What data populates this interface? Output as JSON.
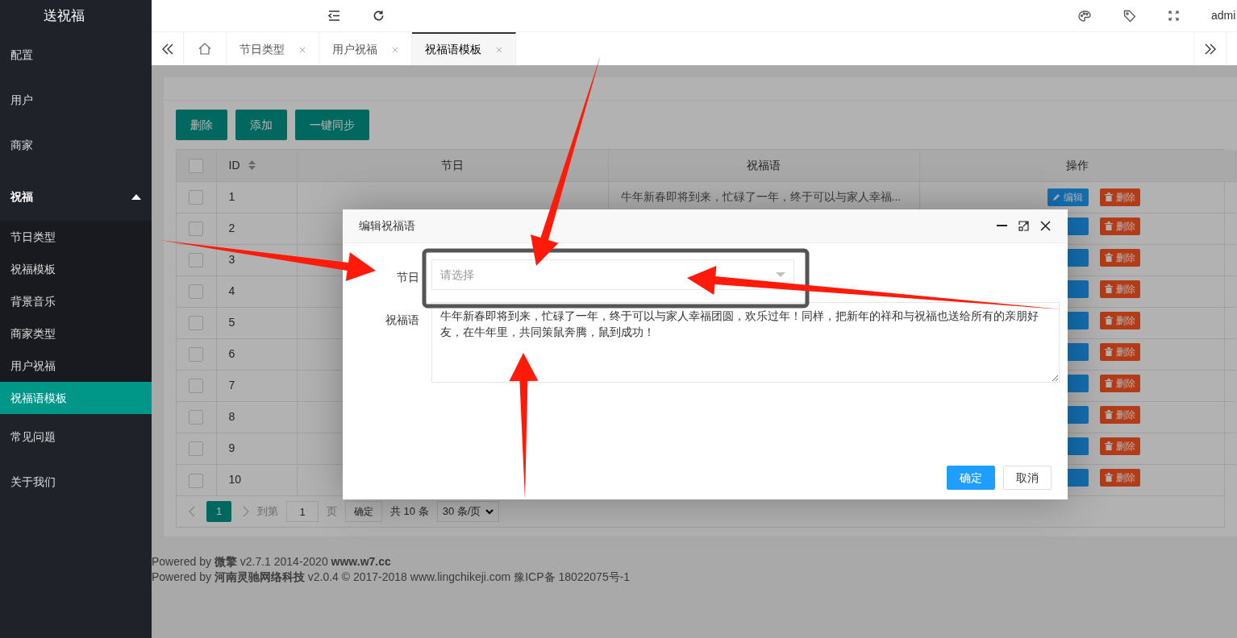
{
  "sidebar": {
    "logo": "送祝福",
    "items": [
      {
        "label": "配置",
        "expanded": false,
        "selected": false
      },
      {
        "label": "用户",
        "expanded": false,
        "selected": false
      },
      {
        "label": "商家",
        "expanded": false,
        "selected": false
      },
      {
        "label": "祝福",
        "expanded": true,
        "selected": false,
        "children": [
          {
            "label": "节日类型",
            "selected": false
          },
          {
            "label": "祝福模板",
            "selected": false
          },
          {
            "label": "背景音乐",
            "selected": false
          },
          {
            "label": "商家类型",
            "selected": false
          },
          {
            "label": "用户祝福",
            "selected": false
          },
          {
            "label": "祝福语模板",
            "selected": true
          }
        ]
      },
      {
        "label": "常见问题",
        "expanded": false,
        "selected": false
      },
      {
        "label": "关于我们",
        "expanded": false,
        "selected": false
      }
    ]
  },
  "header": {
    "user": "admi"
  },
  "tabs": [
    {
      "label": "节日类型",
      "selected": false
    },
    {
      "label": "用户祝福",
      "selected": false
    },
    {
      "label": "祝福语模板",
      "selected": true
    }
  ],
  "toolbar": [
    "删除",
    "添加",
    "一键同步"
  ],
  "table": {
    "all_checked": false,
    "columns": [
      "ID",
      "节日",
      "祝福语",
      "操作"
    ],
    "rows": [
      {
        "id": "1",
        "checked": false,
        "greeting": "牛年新春即将到来，忙碌了一年，终于可以与家人幸福...",
        "edit": "编辑",
        "delete": "删除"
      },
      {
        "id": "2",
        "checked": false,
        "delete": "删除"
      },
      {
        "id": "3",
        "checked": false,
        "delete": "删除"
      },
      {
        "id": "4",
        "checked": false,
        "delete": "删除"
      },
      {
        "id": "5",
        "checked": false,
        "delete": "删除"
      },
      {
        "id": "6",
        "checked": false,
        "delete": "删除"
      },
      {
        "id": "7",
        "checked": false,
        "delete": "删除"
      },
      {
        "id": "8",
        "checked": false,
        "delete": "删除"
      },
      {
        "id": "9",
        "checked": false,
        "delete": "删除"
      },
      {
        "id": "10",
        "checked": false,
        "delete": "删除"
      }
    ]
  },
  "pagination": {
    "current": "1",
    "goto_label": "到第",
    "goto_value": "1",
    "page_label": "页",
    "confirm": "确定",
    "total": "共 10 条",
    "page_size": "30 条/页"
  },
  "footer": [
    "Powered by **微擎** v2.7.1 2014-2020 **www.w7.cc**",
    "Powered by **河南灵驰网络科技** v2.0.4 © 2017-2018 www.lingchikeji.com 豫ICP备 18022075号-1"
  ],
  "dialog": {
    "title": "编辑祝福语",
    "fields": [
      {
        "kind": "select",
        "label": "节日",
        "placeholder": "请选择"
      },
      {
        "kind": "textarea",
        "label": "祝福语",
        "value": "牛年新春即将到来，忙碌了一年，终于可以与家人幸福团圆，欢乐过年！同样，把新年的祥和与祝福也送给所有的亲朋好友，在牛年里，共同策鼠奔腾，鼠到成功！"
      }
    ],
    "buttons": [
      {
        "label": "确定",
        "kind": "primary"
      },
      {
        "label": "取消",
        "kind": "default"
      }
    ]
  },
  "annotations": [
    {
      "kind": "frame"
    },
    {
      "kind": "arrow"
    },
    {
      "kind": "arrow"
    },
    {
      "kind": "arrow"
    },
    {
      "kind": "arrow"
    }
  ]
}
